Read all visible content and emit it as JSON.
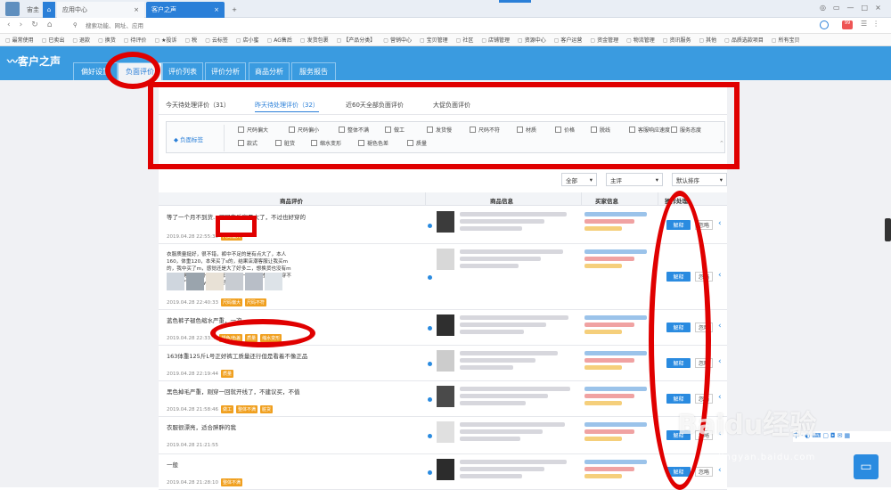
{
  "browser": {
    "tabs": [
      {
        "label": "宙圭",
        "active": false
      },
      {
        "label": "应用中心",
        "active": false
      },
      {
        "label": "客户之声",
        "active": true
      }
    ],
    "address_placeholder": "搜索功能、网址、应用",
    "bookmarks": [
      "最常使用",
      "已卖出",
      "退款",
      "换货",
      "待评价",
      "★投诉",
      "税",
      "云标签",
      "店小蜜",
      "AG售后",
      "发货包裹",
      "【产品分类】",
      "营销中心",
      "宝贝管理",
      "社区",
      "店铺管理",
      "资源中心",
      "客户运营",
      "资金管理",
      "物流管理",
      "资讯服务",
      "其他",
      "品质选款项目",
      "所有宝贝"
    ]
  },
  "app": {
    "logo": "客户之声",
    "nav_tabs": [
      "偏好设置",
      "负面评价",
      "评价列表",
      "评价分析",
      "商品分析",
      "服务报告"
    ],
    "active_nav": "负面评价"
  },
  "subtabs": [
    "今天待处理评价（31）",
    "昨天待处理评价（32）",
    "近60天全部负面评价",
    "大促负面评价"
  ],
  "active_subtab": "昨天待处理评价（32）",
  "tag_filter": {
    "label": "负面标签",
    "row1": [
      "尺码偏大",
      "尺码偏小",
      "整体不满",
      "做工",
      "发货慢",
      "尺码不符",
      "材质",
      "价格",
      "脱线",
      "客服响应速度",
      "服务态度"
    ],
    "row2": [
      "款式",
      "脏货",
      "缩水变形",
      "褪色色差",
      "质量"
    ]
  },
  "filters": {
    "all": "全部",
    "primary": "主评",
    "sort": "默认排序"
  },
  "table": {
    "headers": [
      "商品评价",
      "商品信息",
      "买家信息",
      "操作处理"
    ],
    "reply_label": "解释",
    "ignore_label": "忽略",
    "rows": [
      {
        "text": "等了一个月不到货…买回来后穿是大了，不过也好穿的",
        "date": "2019.04.28 22:55:35",
        "tags": [
          "尺码偏大"
        ]
      },
      {
        "text": "衣服质量挺好，很不错，裤中不足的是有点大了，本人160，体重120，本来买了s的，结果店潮客服让我买m的，我中买了m，感觉还是大了好多二，想换货也没有m的了，懊悔，另外矣在贵阳，等了一个多月才到，也穿不了几天了！1acky服务很好",
        "date": "2019.04.28 22:40:33",
        "tags": [
          "尺码偏大",
          "尺码不符"
        ]
      },
      {
        "text": "蓝色裤子褪色缩水严重，一次…",
        "date": "2019.04.28 22:33:…",
        "tags": [
          "褪色/色差",
          "质量",
          "缩水变形"
        ]
      },
      {
        "text": "163体重125斤L号正好裤工质量还行但是看着不像正品",
        "date": "2019.04.28 22:19:44",
        "tags": [
          "质量"
        ]
      },
      {
        "text": "黑色掉毛严重，刚穿一回就开线了，不建议买，不值",
        "date": "2019.04.28 21:58:46",
        "tags": [
          "做工",
          "整体不满",
          "脏货"
        ]
      },
      {
        "text": "衣服很漂亮，适合胖胖的我",
        "date": "2019.04.28 21:21:55",
        "tags": []
      },
      {
        "text": "一般",
        "date": "2019.04.28 21:28:10",
        "tags": [
          "整体不满"
        ]
      }
    ]
  },
  "watermark": {
    "brand": "Baidu经验",
    "url": "jingyan.baidu.com"
  },
  "colors": {
    "accent": "#2a8be0",
    "header": "#3a9be0",
    "annotation_red": "#e00000",
    "tag": "#f0a020"
  }
}
